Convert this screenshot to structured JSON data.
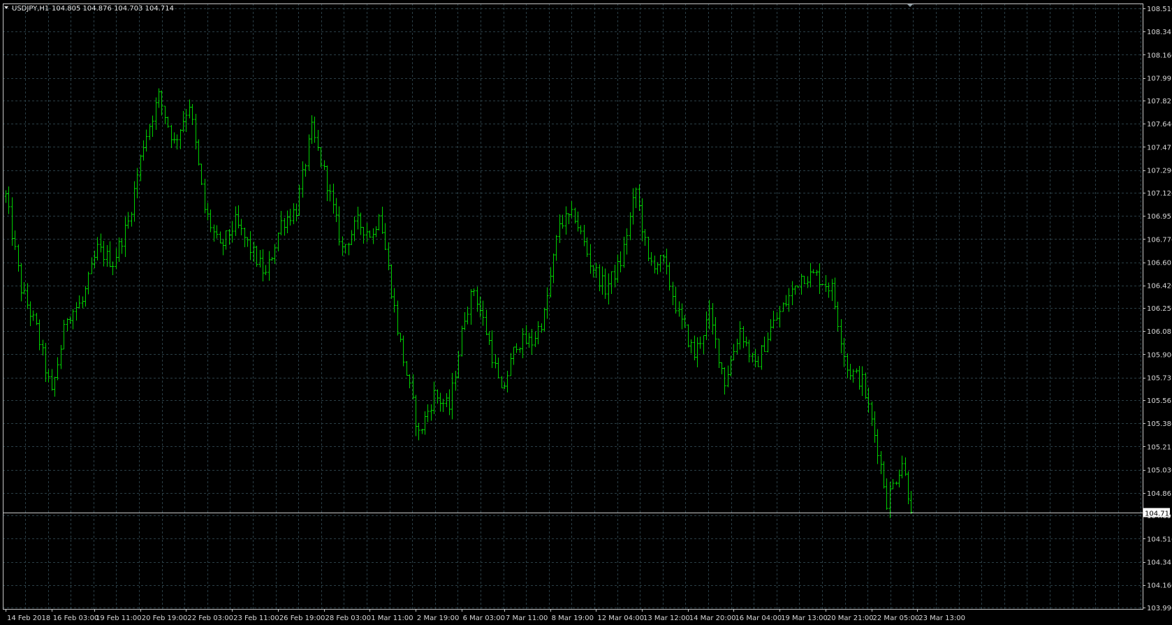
{
  "header": {
    "symbol_label": "USDJPY,H1",
    "ohlc_label": "104.805 104.876 104.703 104.714",
    "collapse_icon": "triangle-down-icon"
  },
  "colors": {
    "background": "#000000",
    "bars": "#00d000",
    "grid": "#2b3f47",
    "axis_text": "#d8d8d8"
  },
  "current_price": 104.714,
  "chart_data": {
    "type": "bar",
    "series": [
      {
        "values": []
      }
    ],
    "price_anchors": [
      [
        0,
        107.1
      ],
      [
        5,
        106.4
      ],
      [
        10,
        106.1
      ],
      [
        15,
        105.6
      ],
      [
        20,
        106.2
      ],
      [
        25,
        106.3
      ],
      [
        30,
        106.7
      ],
      [
        35,
        106.6
      ],
      [
        40,
        106.9
      ],
      [
        45,
        107.5
      ],
      [
        50,
        107.85
      ],
      [
        55,
        107.5
      ],
      [
        60,
        107.8
      ],
      [
        65,
        107.0
      ],
      [
        70,
        106.7
      ],
      [
        75,
        106.9
      ],
      [
        80,
        106.7
      ],
      [
        85,
        106.5
      ],
      [
        90,
        106.9
      ],
      [
        95,
        107.0
      ],
      [
        100,
        107.6
      ],
      [
        105,
        107.2
      ],
      [
        110,
        106.7
      ],
      [
        115,
        106.9
      ],
      [
        120,
        106.8
      ],
      [
        122,
        107.0
      ],
      [
        128,
        106.1
      ],
      [
        135,
        105.3
      ],
      [
        140,
        105.6
      ],
      [
        145,
        105.5
      ],
      [
        150,
        106.2
      ],
      [
        153,
        106.4
      ],
      [
        158,
        106.0
      ],
      [
        162,
        105.6
      ],
      [
        167,
        106.0
      ],
      [
        172,
        106.0
      ],
      [
        176,
        106.2
      ],
      [
        181,
        106.9
      ],
      [
        186,
        106.95
      ],
      [
        191,
        106.6
      ],
      [
        196,
        106.4
      ],
      [
        201,
        106.6
      ],
      [
        206,
        107.15
      ],
      [
        210,
        106.6
      ],
      [
        215,
        106.6
      ],
      [
        220,
        106.2
      ],
      [
        225,
        105.9
      ],
      [
        230,
        106.2
      ],
      [
        235,
        105.7
      ],
      [
        240,
        106.1
      ],
      [
        245,
        105.8
      ],
      [
        250,
        106.1
      ],
      [
        255,
        106.3
      ],
      [
        260,
        106.5
      ],
      [
        265,
        106.5
      ],
      [
        270,
        106.4
      ],
      [
        275,
        105.8
      ],
      [
        280,
        105.7
      ],
      [
        285,
        105.2
      ],
      [
        288,
        104.8
      ],
      [
        293,
        105.1
      ],
      [
        296,
        104.75
      ]
    ],
    "x_ticks": [
      {
        "label": "14 Feb 2018",
        "index": 0
      },
      {
        "label": "16 Feb 03:00",
        "index": 15
      },
      {
        "label": "19 Feb 11:00",
        "index": 29
      },
      {
        "label": "20 Feb 19:00",
        "index": 44
      },
      {
        "label": "22 Feb 03:00",
        "index": 59
      },
      {
        "label": "23 Feb 11:00",
        "index": 74
      },
      {
        "label": "26 Feb 19:00",
        "index": 89
      },
      {
        "label": "28 Feb 03:00",
        "index": 104
      },
      {
        "label": "1 Mar 11:00",
        "index": 119
      },
      {
        "label": "2 Mar 19:00",
        "index": 134
      },
      {
        "label": "6 Mar 03:00",
        "index": 149
      },
      {
        "label": "7 Mar 11:00",
        "index": 163
      },
      {
        "label": "8 Mar 19:00",
        "index": 178
      },
      {
        "label": "12 Mar 04:00",
        "index": 193
      },
      {
        "label": "13 Mar 12:00",
        "index": 208
      },
      {
        "label": "14 Mar 20:00",
        "index": 223
      },
      {
        "label": "16 Mar 04:00",
        "index": 238
      },
      {
        "label": "19 Mar 13:00",
        "index": 253
      },
      {
        "label": "20 Mar 21:00",
        "index": 268
      },
      {
        "label": "22 Mar 05:00",
        "index": 283
      },
      {
        "label": "23 Mar 13:00",
        "index": 298
      }
    ],
    "y_ticks": [
      "108.516",
      "108.341",
      "108.166",
      "107.991",
      "107.821",
      "107.646",
      "107.471",
      "107.296",
      "107.126",
      "106.951",
      "106.776",
      "106.601",
      "106.426",
      "106.256",
      "106.081",
      "105.906",
      "105.731",
      "105.561",
      "105.386",
      "105.211",
      "105.036",
      "104.861",
      "104.691",
      "104.516",
      "104.341",
      "104.166",
      "103.996"
    ],
    "ylim": [
      103.996,
      108.516
    ],
    "grid": true,
    "title": "",
    "xlabel": "",
    "ylabel": ""
  }
}
